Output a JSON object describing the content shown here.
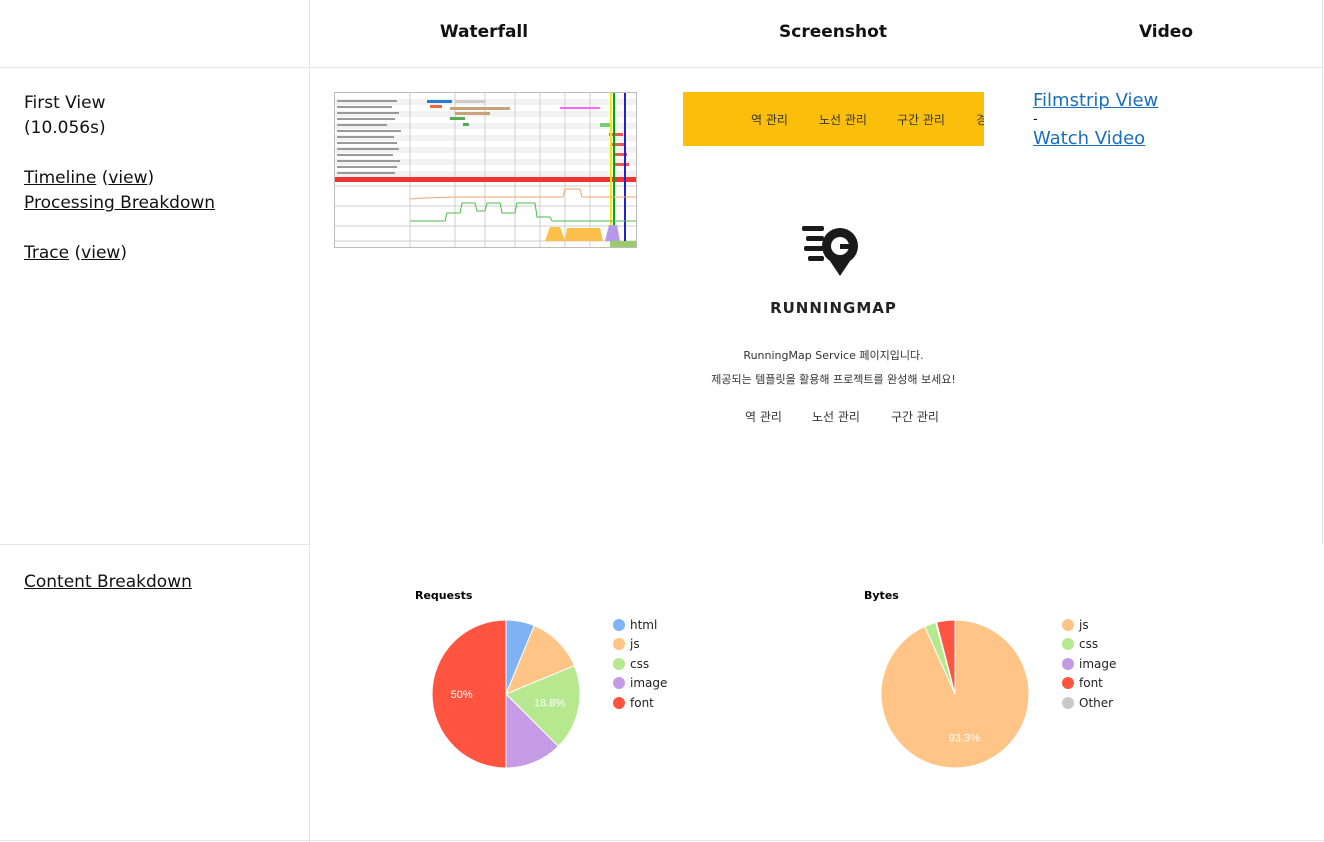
{
  "headers": {
    "waterfall": "Waterfall",
    "screenshot": "Screenshot",
    "video": "Video"
  },
  "first_view": {
    "title": "First View",
    "time": "(10.056s)",
    "timeline": "Timeline",
    "view": "view",
    "processing": "Processing Breakdown",
    "trace": "Trace"
  },
  "video": {
    "filmstrip": "Filmstrip View",
    "sep": "-",
    "watch": "Watch Video"
  },
  "screenshot": {
    "nav": [
      "역 관리",
      "노선 관리",
      "구간 관리",
      "경"
    ],
    "brand": "RUNNINGMAP",
    "line1": "RunningMap Service 페이지입니다.",
    "line2": "제공되는 템플릿을 활용해 프로젝트를 완성해 보세요!",
    "menu": [
      "역 관리",
      "노선 관리",
      "구간 관리"
    ],
    "bar_color": "#fbbf0b"
  },
  "content_breakdown": "Content Breakdown",
  "chart_data": [
    {
      "type": "pie",
      "title": "Requests",
      "categories": [
        "html",
        "js",
        "css",
        "image",
        "font"
      ],
      "values": [
        6.25,
        12.5,
        18.75,
        12.5,
        50
      ],
      "labels": [
        "",
        "",
        "18.8%",
        "",
        "50%"
      ],
      "colors": [
        "#7fb3f5",
        "#ffc486",
        "#b5e88f",
        "#c59be6",
        "#ff5540"
      ],
      "legend": "right"
    },
    {
      "type": "pie",
      "title": "Bytes",
      "categories": [
        "js",
        "css",
        "image",
        "font",
        "Other"
      ],
      "values": [
        93.3,
        2.5,
        0.2,
        4.0,
        0
      ],
      "labels": [
        "93.3%",
        "",
        "",
        "",
        ""
      ],
      "colors": [
        "#ffc486",
        "#b5e88f",
        "#c59be6",
        "#ff5540",
        "#c8c8c8"
      ],
      "legend": "right"
    }
  ]
}
